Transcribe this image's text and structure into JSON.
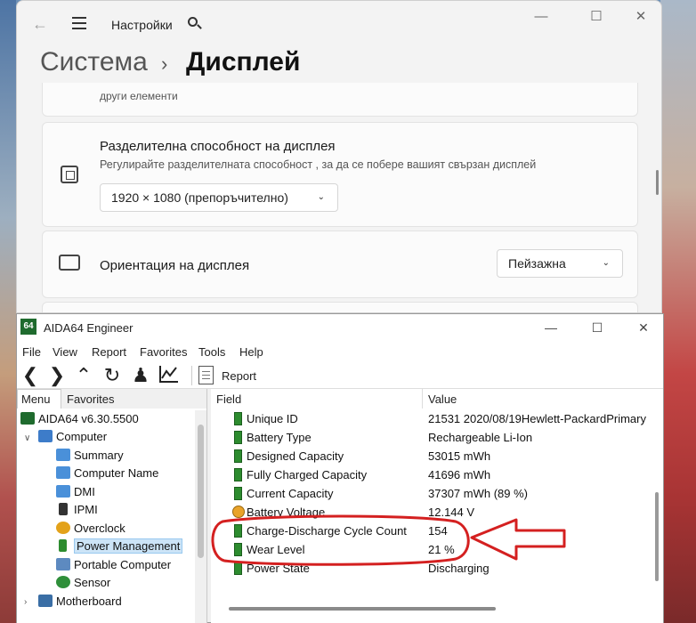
{
  "settings": {
    "app_title": "Настройки",
    "breadcrumb_root": "Система",
    "breadcrumb_separator": "›",
    "breadcrumb_current": "Дисплей",
    "partial_card_text": "други елементи",
    "resolution": {
      "title": "Разделителна способност на дисплея",
      "subtitle": "Регулирайте разделителната способност , за да се побере вашият свързан дисплей",
      "value": "1920 × 1080 (препоръчително)"
    },
    "orientation": {
      "title": "Ориентация на дисплея",
      "value": "Пейзажна"
    }
  },
  "aida": {
    "icon_text": "64",
    "window_title": "AIDA64 Engineer",
    "menu": [
      "File",
      "View",
      "Report",
      "Favorites",
      "Tools",
      "Help"
    ],
    "toolbar_report": "Report",
    "tabs": [
      "Menu",
      "Favorites"
    ],
    "tree": [
      {
        "label": "AIDA64 v6.30.5500",
        "icon": "aida-app-icon"
      },
      {
        "label": "Computer",
        "icon": "computer-icon"
      },
      {
        "label": "Summary",
        "icon": "summary-icon"
      },
      {
        "label": "Computer Name",
        "icon": "computer-name-icon"
      },
      {
        "label": "DMI",
        "icon": "dmi-icon"
      },
      {
        "label": "IPMI",
        "icon": "ipmi-icon"
      },
      {
        "label": "Overclock",
        "icon": "overclock-icon"
      },
      {
        "label": "Power Management",
        "icon": "battery-icon"
      },
      {
        "label": "Portable Computer",
        "icon": "portable-computer-icon"
      },
      {
        "label": "Sensor",
        "icon": "sensor-icon"
      },
      {
        "label": "Motherboard",
        "icon": "motherboard-icon"
      }
    ],
    "columns": [
      "Field",
      "Value"
    ],
    "rows": [
      {
        "field": "Unique ID",
        "value": "21531 2020/08/19Hewlett-PackardPrimary"
      },
      {
        "field": "Battery Type",
        "value": "Rechargeable Li-Ion"
      },
      {
        "field": "Designed Capacity",
        "value": "53015 mWh"
      },
      {
        "field": "Fully Charged Capacity",
        "value": "41696 mWh"
      },
      {
        "field": "Current Capacity",
        "value": "37307 mWh  (89 %)"
      },
      {
        "field": "Battery Voltage",
        "value": "12.144 V"
      },
      {
        "field": "Charge-Discharge Cycle Count",
        "value": "154"
      },
      {
        "field": "Wear Level",
        "value": "21 %"
      },
      {
        "field": "Power State",
        "value": "Discharging"
      }
    ]
  },
  "annotation_color": "#d42020"
}
